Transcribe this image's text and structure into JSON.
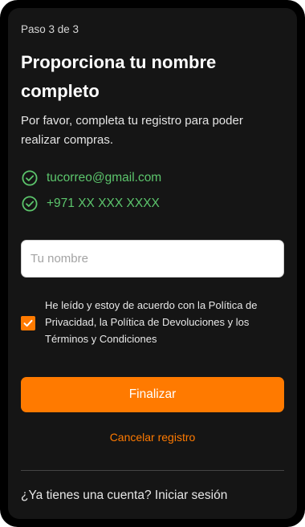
{
  "step": "Paso 3 de 3",
  "title": "Proporciona tu nombre completo",
  "subtitle": "Por favor, completa tu registro para poder realizar compras.",
  "verified": {
    "email": "tucorreo@gmail.com",
    "phone": "+971 XX XXX XXXX"
  },
  "name_input": {
    "placeholder": "Tu nombre",
    "value": ""
  },
  "consent": {
    "checked": true,
    "text": "He leído y estoy de acuerdo con la Política de Privacidad, la Política de Devoluciones y los Términos y Condiciones"
  },
  "actions": {
    "primary": "Finalizar",
    "cancel": "Cancelar registro"
  },
  "footer": "¿Ya tienes una cuenta? Iniciar sesión",
  "icons": {
    "verified": "check-circle-icon",
    "checkbox": "checkmark-icon"
  },
  "colors": {
    "accent": "#ff7a00",
    "success": "#5cc56c",
    "background": "#151515"
  }
}
